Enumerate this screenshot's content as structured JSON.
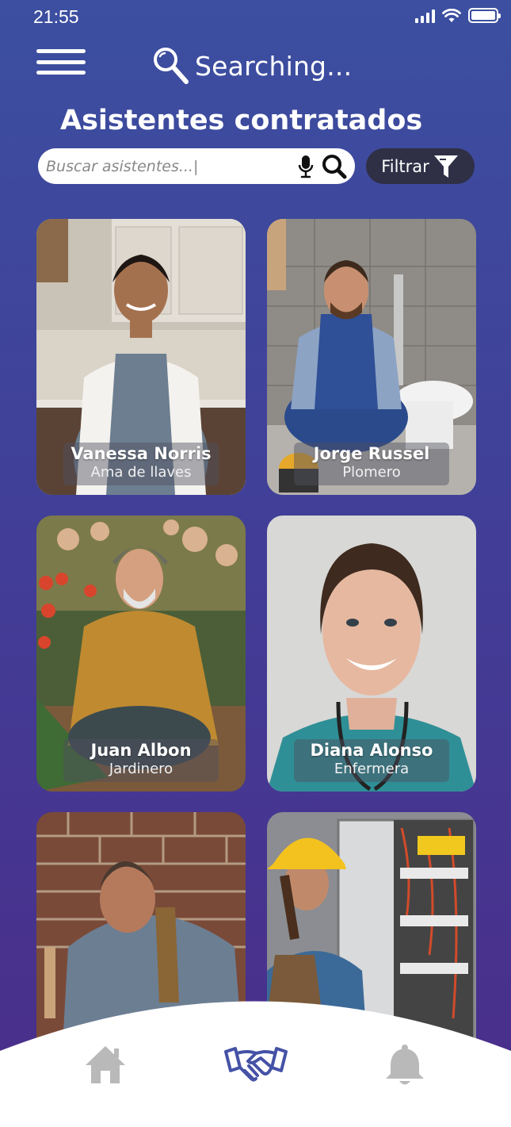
{
  "status": {
    "time": "21:55"
  },
  "header": {
    "menu_icon": "hamburger-menu-icon",
    "searching_label": "Searching...",
    "title": "Asistentes contratados"
  },
  "search": {
    "placeholder": "Buscar asistentes...|",
    "mic_icon": "microphone-icon",
    "search_icon": "search-icon"
  },
  "filter": {
    "label": "Filtrar",
    "icon": "funnel-icon"
  },
  "assistants": [
    {
      "name": "Vanessa Norris",
      "role": "Ama de llaves"
    },
    {
      "name": "Jorge Russel",
      "role": "Plomero"
    },
    {
      "name": "Juan Albon",
      "role": "Jardinero"
    },
    {
      "name": "Diana Alonso",
      "role": "Enfermera"
    },
    {
      "name": "",
      "role": ""
    },
    {
      "name": "",
      "role": ""
    }
  ],
  "bottom_nav": {
    "items": [
      {
        "icon": "home-icon",
        "active": false
      },
      {
        "icon": "handshake-icon",
        "active": true
      },
      {
        "icon": "bell-icon",
        "active": false
      }
    ],
    "active_color": "#4552a6",
    "inactive_color": "#b9b9b9"
  }
}
